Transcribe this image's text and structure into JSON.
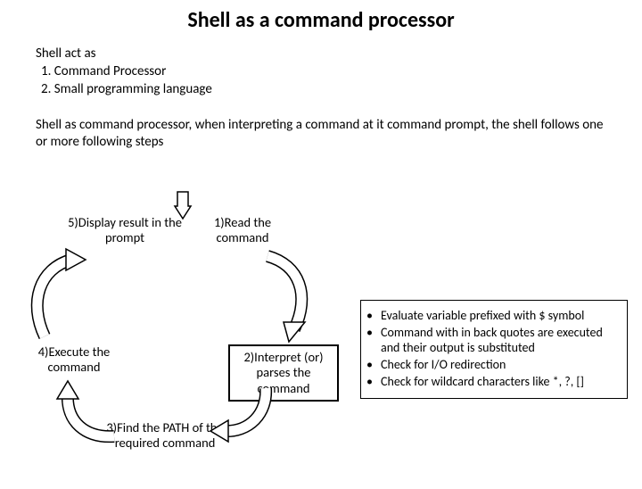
{
  "title": "Shell as a command processor",
  "intro": {
    "lead": "Shell act as",
    "items": [
      "1.   Command Processor",
      "2.   Small programming language"
    ]
  },
  "paragraph": "Shell as command processor, when interpreting a command at it command prompt, the shell follows one or more following steps",
  "steps": {
    "s1": "1)Read the command",
    "s2": "2)Interpret (or) parses the command",
    "s3": "3)Find the PATH of the required command",
    "s4": "4)Execute the command",
    "s5": "5)Display result in the prompt"
  },
  "bullets": [
    "Evaluate variable prefixed with $ symbol",
    "Command with in back quotes are executed and their output is substituted",
    "Check for I/O redirection",
    "Check for wildcard characters like *, ?, []"
  ]
}
